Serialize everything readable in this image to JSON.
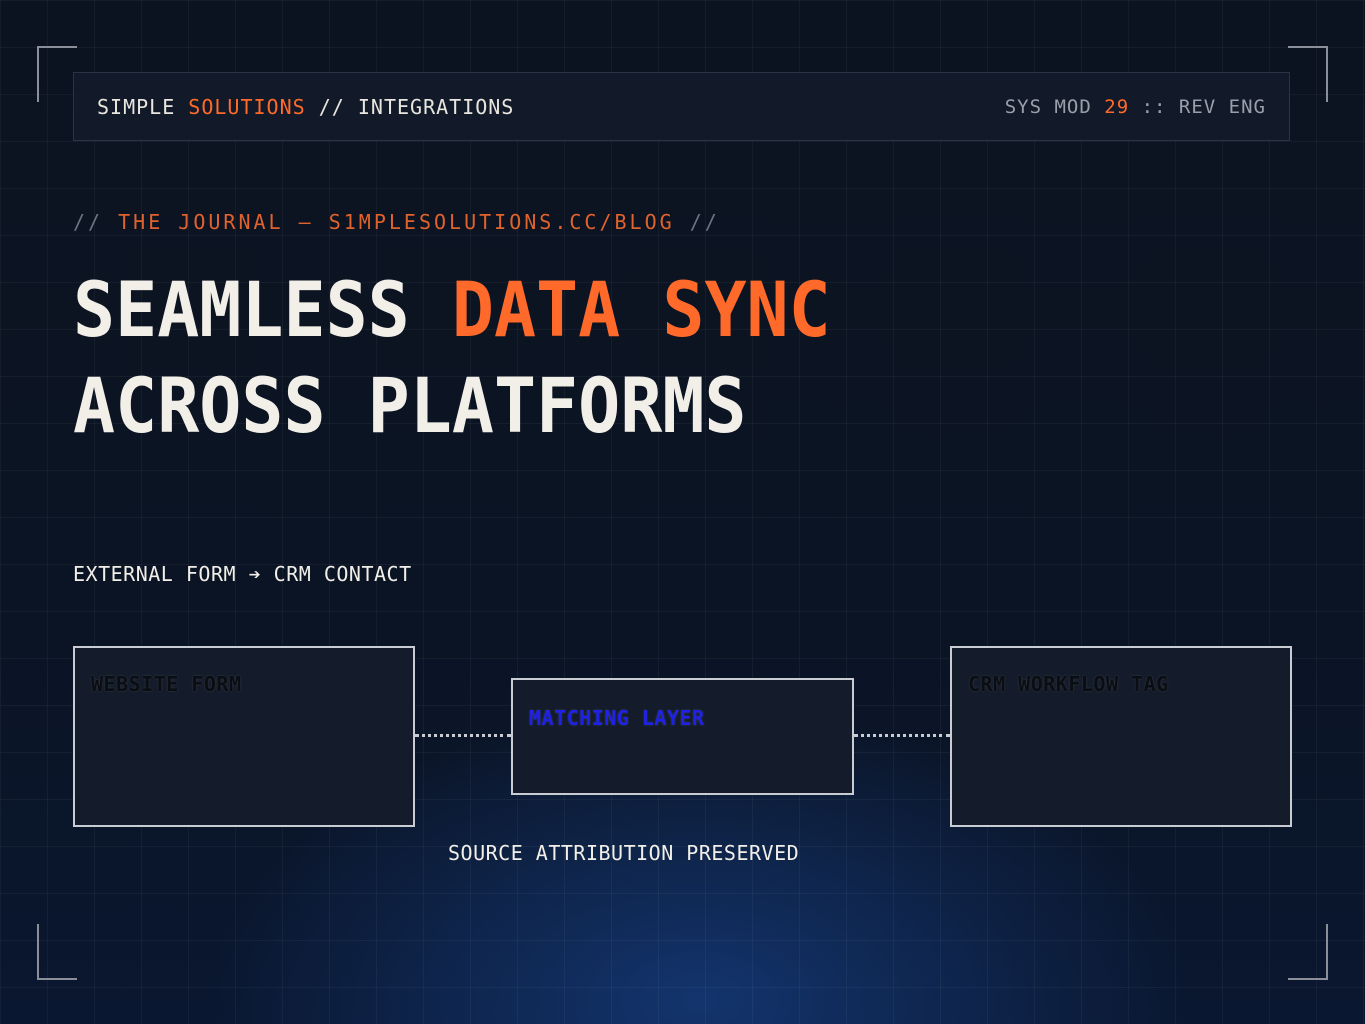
{
  "header": {
    "brand_simple": "SIMPLE",
    "brand_solutions": "SOLUTIONS",
    "brand_sep": "//",
    "brand_section": "INTEGRATIONS",
    "sys_prefix": "SYS MOD",
    "sys_number": "29",
    "sys_suffix": ":: REV ENG"
  },
  "journal": {
    "open": "//",
    "text": "THE JOURNAL — S1MPLESOLUTIONS.CC/BLOG",
    "close": "//"
  },
  "headline": {
    "line1_white": "SEAMLESS",
    "line1_accent": "DATA SYNC",
    "line2": "ACROSS PLATFORMS"
  },
  "flow": {
    "label": "EXTERNAL FORM ➔ CRM CONTACT",
    "nodes": [
      {
        "label": "WEBSITE FORM"
      },
      {
        "label": "MATCHING LAYER"
      },
      {
        "label": "CRM WORKFLOW TAG"
      }
    ],
    "caption": "SOURCE ATTRIBUTION PRESERVED"
  },
  "colors": {
    "accent": "#ff6a2a",
    "background": "#0b1220",
    "matching_label": "#1f22e6"
  }
}
